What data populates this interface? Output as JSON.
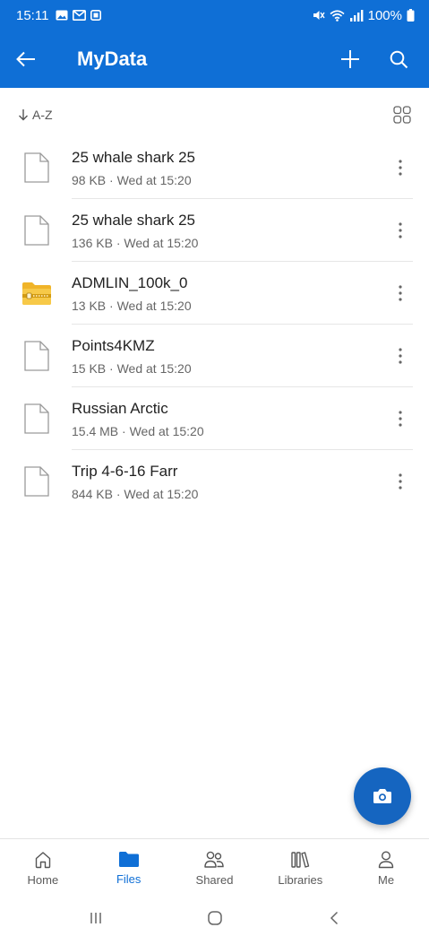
{
  "status_bar": {
    "time": "15:11",
    "battery": "100%"
  },
  "app_bar": {
    "title": "MyData"
  },
  "sort": {
    "label": "A-Z"
  },
  "files": [
    {
      "name": "25 whale shark 25",
      "meta": "98 KB · Wed at 15:20",
      "type": "file"
    },
    {
      "name": "25 whale shark 25",
      "meta": "136 KB · Wed at 15:20",
      "type": "file"
    },
    {
      "name": "ADMLIN_100k_0",
      "meta": "13 KB · Wed at 15:20",
      "type": "zip-folder"
    },
    {
      "name": "Points4KMZ",
      "meta": "15 KB · Wed at 15:20",
      "type": "file"
    },
    {
      "name": "Russian Arctic",
      "meta": "15.4 MB · Wed at 15:20",
      "type": "file"
    },
    {
      "name": "Trip 4-6-16 Farr",
      "meta": "844 KB · Wed at 15:20",
      "type": "file"
    }
  ],
  "bottom_nav": {
    "home": "Home",
    "files": "Files",
    "shared": "Shared",
    "libraries": "Libraries",
    "me": "Me"
  },
  "colors": {
    "brand": "#0f6fd6",
    "fab": "#1565c0",
    "folder": "#f5c242"
  }
}
